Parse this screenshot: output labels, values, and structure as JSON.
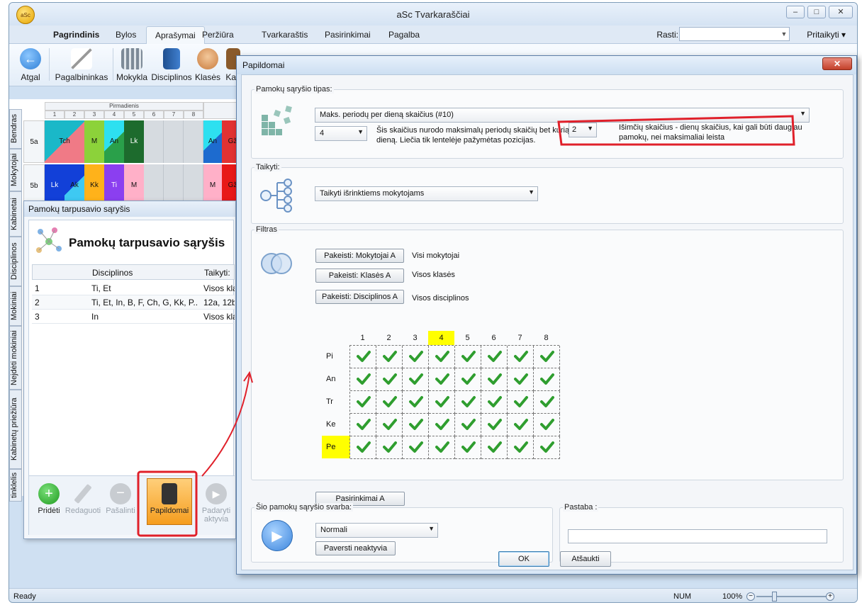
{
  "app": {
    "title": "aSc Tvarkaraščiai",
    "logo_text": "aSc",
    "tabs": [
      "Pagrindinis",
      "Bylos",
      "Aprašymai",
      "Peržiūra",
      "Tvarkaraštis",
      "Pasirinkimai",
      "Pagalba"
    ],
    "active_tab": "Aprašymai",
    "search_label": "Rasti:",
    "customize_label": "Pritaikyti ▾",
    "ribbon": [
      "Atgal",
      "Pagalbininkas",
      "Mokykla",
      "Disciplinos",
      "Klasės",
      "Kab"
    ],
    "status_ready": "Ready",
    "status_num": "NUM",
    "zoom": "100%"
  },
  "timetable": {
    "day_header": "Pirmadienis",
    "periods": [
      "1",
      "2",
      "3",
      "4",
      "5",
      "6",
      "7",
      "8"
    ],
    "side_tabs": [
      "Bendras",
      "Mokytojai",
      "Kabinetai",
      "Disciplinos",
      "Mokiniai",
      "Nejdėti mokiniai",
      "Kabinetų priežiūra",
      "tinklelis"
    ],
    "rows": [
      {
        "label": "5a",
        "cells": [
          "Tch",
          "M",
          "An",
          "Lk"
        ],
        "right": [
          "An",
          "Gž"
        ]
      },
      {
        "label": "5b",
        "cells": [
          "Lk",
          "Ak",
          "Kk",
          "Ti",
          "M"
        ],
        "right": [
          "M",
          "Gž"
        ]
      }
    ]
  },
  "relations": {
    "window_title": "Pamokų tarpusavio sąryšis",
    "heading": "Pamokų tarpusavio sąryšis",
    "columns": [
      "Disciplinos",
      "Taikyti:"
    ],
    "rows": [
      {
        "n": "1",
        "disc": "Ti, Et",
        "apply": "Visos klas"
      },
      {
        "n": "2",
        "disc": "Ti, Et, In, B, F, Ch, G, Kk, P...",
        "apply": "12a, 12b"
      },
      {
        "n": "3",
        "disc": "In",
        "apply": "Visos klas"
      }
    ],
    "toolbar": {
      "add": "Pridėti",
      "edit": "Redaguoti",
      "remove": "Pašalinti",
      "extra": "Papildomai",
      "activate_line1": "Padaryti",
      "activate_line2": "aktyvia"
    }
  },
  "dialog": {
    "title": "Papildomai",
    "close": "✕",
    "type_group": "Pamokų sąryšio tipas:",
    "type_value": "Maks. periodų per dieną skaičius (#10)",
    "max_value": "4",
    "max_desc_1": "Šis skaičius nurodo maksimalų periodų skaičių bet kurią",
    "max_desc_2": "dieną. Liečia tik lentelėje pažymėtas pozicijas.",
    "exceptions_value": "2",
    "exceptions_desc_1": "Išimčių skaičius - dienų skaičius, kai gali būti daugiau",
    "exceptions_desc_2": "pamokų, nei maksimaliai leista",
    "apply_group": "Taikyti:",
    "apply_value": "Taikyti išrinktiems mokytojams",
    "filter_group": "Filtras",
    "filters": [
      {
        "button": "Pakeisti: Mokytojai A",
        "label": "Visi mokytojai"
      },
      {
        "button": "Pakeisti: Klasės A",
        "label": "Visos klasės"
      },
      {
        "button": "Pakeisti: Disciplinos A",
        "label": "Visos disciplinos"
      }
    ],
    "grid_periods": [
      "1",
      "2",
      "3",
      "4",
      "5",
      "6",
      "7",
      "8"
    ],
    "grid_days": [
      "Pi",
      "An",
      "Tr",
      "Ke",
      "Pe"
    ],
    "highlight_period": "4",
    "highlight_day": "Pe",
    "options_button": "Pasirinkimai A",
    "importance_group": "Šio pamokų sąryšio svarba:",
    "importance_value": "Normali",
    "inactive_button": "Paversti neaktyvia",
    "note_group": "Pastaba :",
    "ok": "OK",
    "cancel": "Atšaukti"
  },
  "colors": {
    "accent_red": "#e0202a",
    "check_green": "#2f9e2f",
    "highlight_yellow": "#ffff00"
  }
}
